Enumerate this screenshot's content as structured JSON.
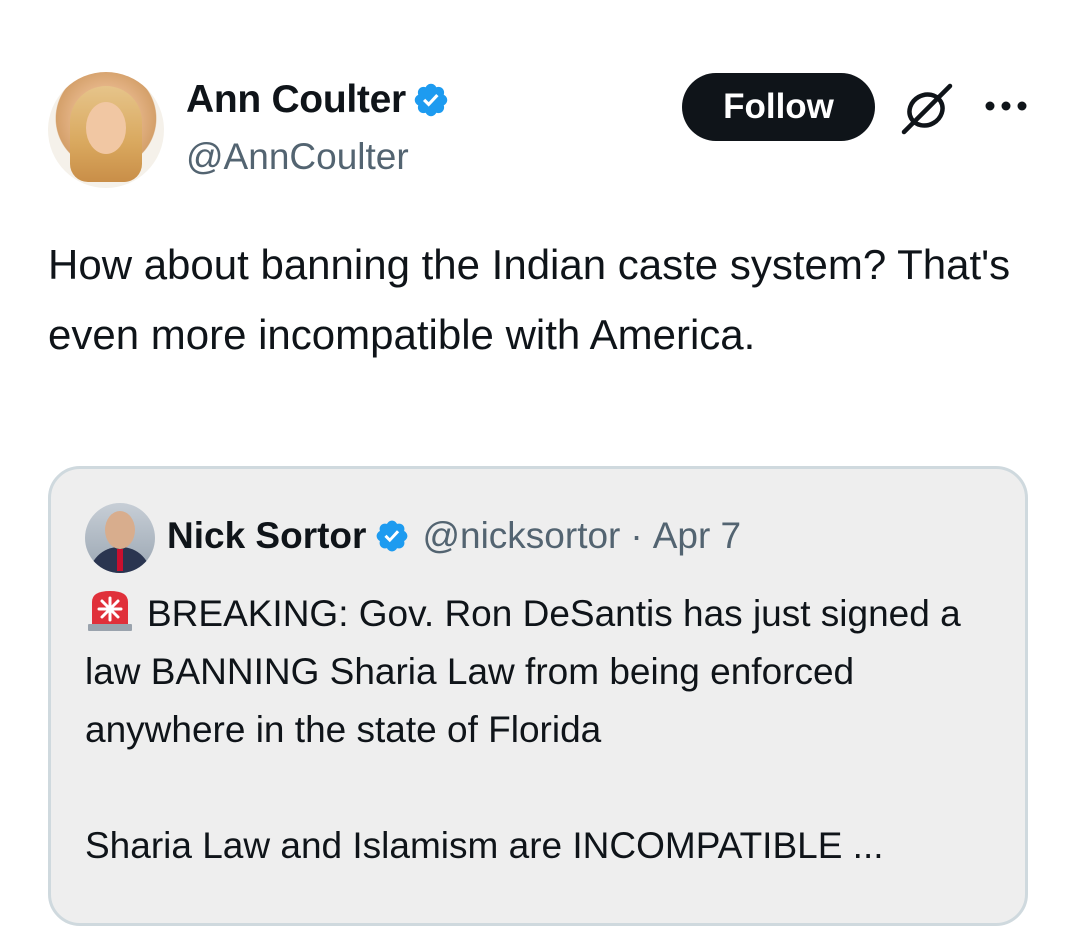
{
  "author": {
    "name": "Ann Coulter",
    "handle": "@AnnCoulter"
  },
  "actions": {
    "follow_label": "Follow"
  },
  "icons": {
    "verified": "verified-badge-icon",
    "grok": "grok-icon",
    "more": "more-options-icon",
    "siren": "rotating-light-emoji"
  },
  "tweet": {
    "text": "How about banning the Indian caste system? That's even more incompatible with America."
  },
  "quoted": {
    "name": "Nick Sortor",
    "handle": "@nicksortor",
    "separator": "·",
    "date": "Apr 7",
    "line1": "BREAKING: Gov. Ron DeSantis has just signed a law BANNING Sharia Law from being enforced anywhere in the state of Florida",
    "line2": "Sharia Law and Islamism are INCOMPATIBLE ..."
  },
  "colors": {
    "text": "#0f1419",
    "secondary": "#536471",
    "verified": "#1d9bf0",
    "follow_bg": "#0f1419",
    "quote_bg": "#eeeeee",
    "quote_border": "#cfd9de"
  }
}
